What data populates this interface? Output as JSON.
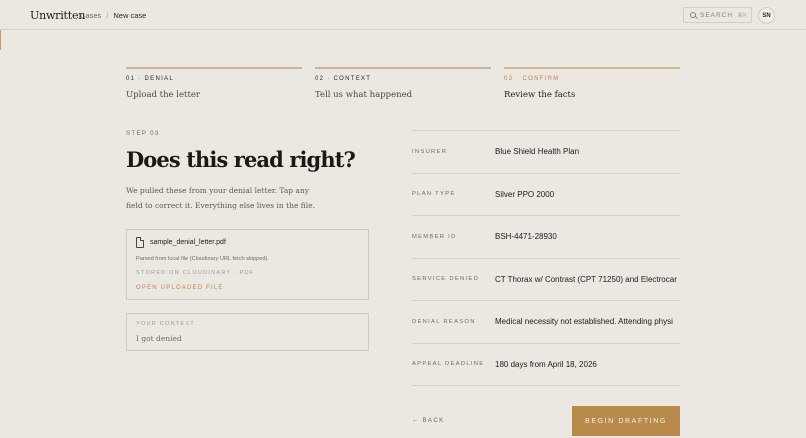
{
  "app": {
    "brand": "Unwritten"
  },
  "breadcrumb": {
    "root": "Cases",
    "separator": "/",
    "current": "New case"
  },
  "search": {
    "label": "SEARCH",
    "shortcut": "⌘K"
  },
  "user": {
    "initials": "SN"
  },
  "steps": [
    {
      "number": "01 · DENIAL",
      "title": "Upload the letter",
      "active": false
    },
    {
      "number": "02 · CONTEXT",
      "title": "Tell us what happened",
      "active": false
    },
    {
      "number": "03 · CONFIRM",
      "title": "Review the facts",
      "active": true
    }
  ],
  "main": {
    "eyebrow": "STEP 03",
    "headline": "Does this read right?",
    "intro": "We pulled these from your denial letter. Tap any field to correct it. Everything else lives in the file."
  },
  "file": {
    "name": "sample_denial_letter.pdf",
    "parsed_note": "Parsed from local file (Cloudinary URL fetch skipped).",
    "stored": "STORED ON CLOUDINARY · PDF",
    "open_link": "OPEN UPLOADED FILE"
  },
  "context": {
    "label": "YOUR CONTEXT",
    "value": "I got denied"
  },
  "facts": [
    {
      "key": "INSURER",
      "value": "Blue Shield Health Plan"
    },
    {
      "key": "PLAN TYPE",
      "value": "Silver PPO 2000"
    },
    {
      "key": "MEMBER ID",
      "value": "BSH-4471-28930"
    },
    {
      "key": "SERVICE DENIED",
      "value": "CT Thorax w/ Contrast (CPT 71250) and Electrocar"
    },
    {
      "key": "DENIAL REASON",
      "value": "Medical necessity not established. Attending physi"
    },
    {
      "key": "APPEAL DEADLINE",
      "value": "180 days from April 18, 2026"
    }
  ],
  "actions": {
    "back": "← BACK",
    "primary": "BEGIN DRAFTING"
  },
  "colors": {
    "accent": "#b88b4c",
    "background": "#ebe8e2",
    "text": "#1e1c19"
  }
}
